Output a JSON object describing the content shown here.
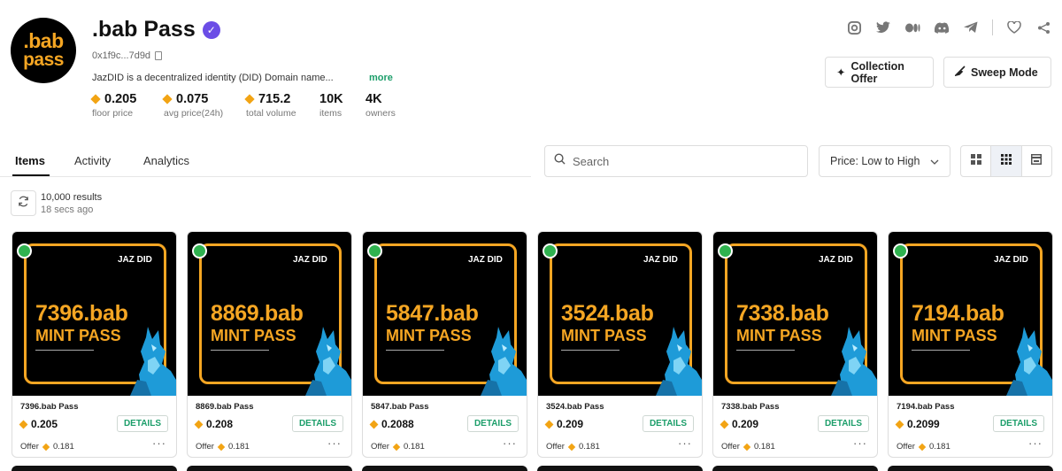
{
  "collection": {
    "logo_line1": ".bab",
    "logo_line2": "pass",
    "title": ".bab Pass",
    "address": "0x1f9c...7d9d",
    "description": "JazDID is a decentralized identity (DID) Domain name...",
    "more_label": "more",
    "stats": [
      {
        "value": "0.205",
        "label": "floor price",
        "currency": true
      },
      {
        "value": "0.075",
        "label": "avg price(24h)",
        "currency": true
      },
      {
        "value": "715.2",
        "label": "total volume",
        "currency": true
      },
      {
        "value": "10K",
        "label": "items",
        "currency": false
      },
      {
        "value": "4K",
        "label": "owners",
        "currency": false
      }
    ]
  },
  "socials": [
    "instagram-icon",
    "twitter-icon",
    "medium-icon",
    "discord-icon",
    "telegram-icon",
    "heart-icon",
    "share-icon"
  ],
  "actions": {
    "collection_offer": "Collection Offer",
    "sweep_mode": "Sweep Mode"
  },
  "tabs": [
    "Items",
    "Activity",
    "Analytics"
  ],
  "search": {
    "placeholder": "Search"
  },
  "sort": {
    "selected": "Price: Low to High"
  },
  "results": {
    "count": "10,000 results",
    "updated": "18 secs ago"
  },
  "items": [
    {
      "number": "7396.bab",
      "name": "7396.bab Pass",
      "price": "0.205",
      "offer": "0.181"
    },
    {
      "number": "8869.bab",
      "name": "8869.bab Pass",
      "price": "0.208",
      "offer": "0.181"
    },
    {
      "number": "5847.bab",
      "name": "5847.bab Pass",
      "price": "0.2088",
      "offer": "0.181"
    },
    {
      "number": "3524.bab",
      "name": "3524.bab Pass",
      "price": "0.209",
      "offer": "0.181"
    },
    {
      "number": "7338.bab",
      "name": "7338.bab Pass",
      "price": "0.209",
      "offer": "0.181"
    },
    {
      "number": "7194.bab",
      "name": "7194.bab Pass",
      "price": "0.2099",
      "offer": "0.181"
    }
  ],
  "card_labels": {
    "brand": "JAZ DID",
    "mint": "MINT PASS",
    "details": "DETAILS",
    "offer": "Offer"
  },
  "colors": {
    "accent": "#f5a623",
    "green": "#1c9e6a",
    "verified": "#6b4de6"
  }
}
